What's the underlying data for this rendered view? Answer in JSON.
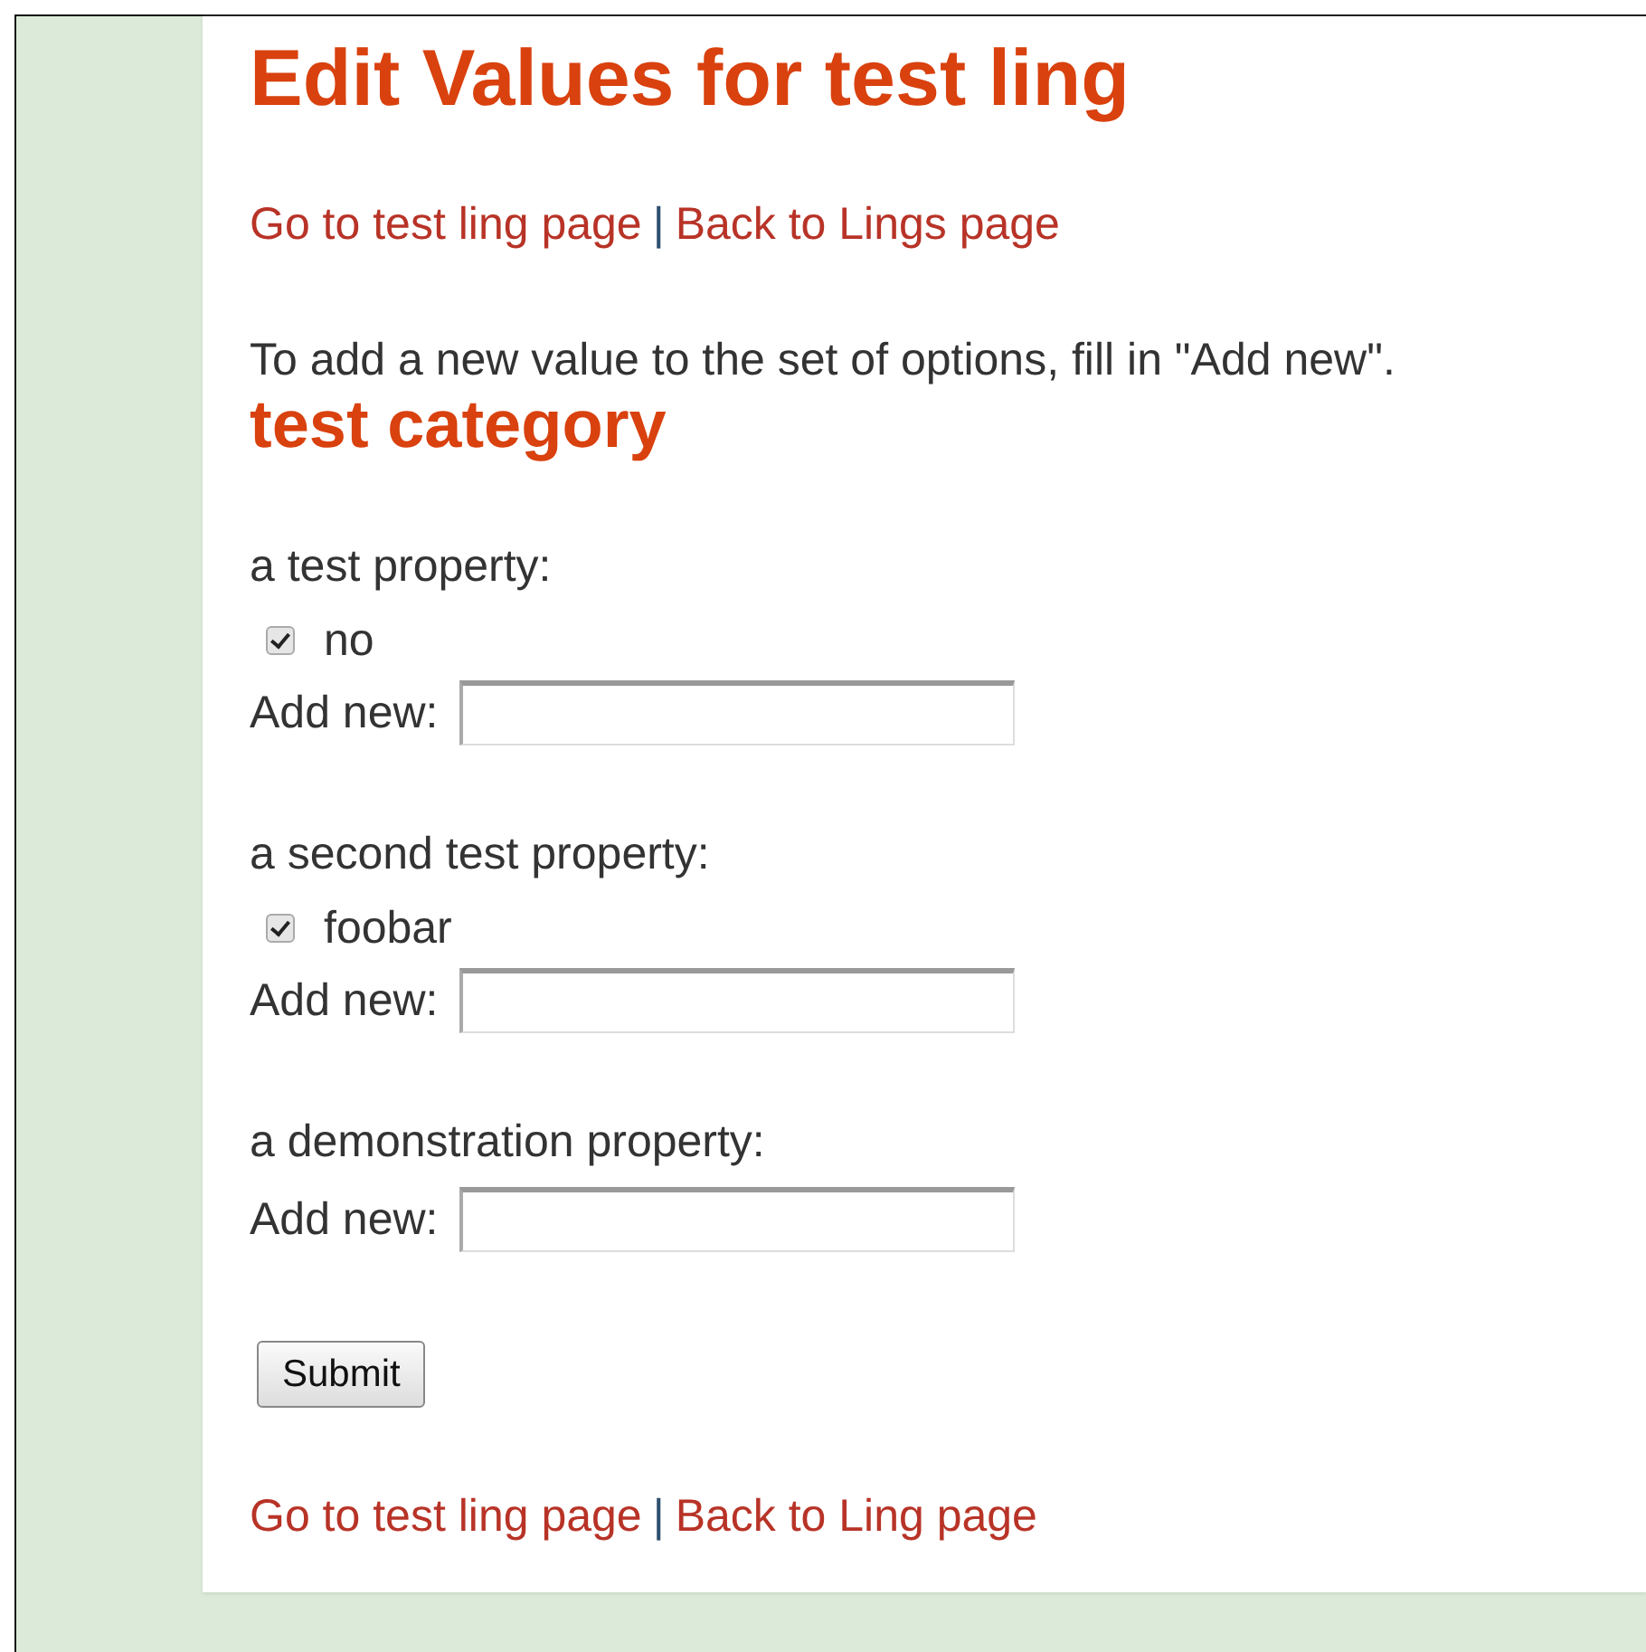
{
  "title": "Edit Values for test ling",
  "top_nav": {
    "links": [
      {
        "label": "Go to test ling page"
      },
      {
        "label": "Back to Lings page"
      }
    ],
    "separator": "|"
  },
  "intro": "To add a new value to the set of options, fill in \"Add new\".",
  "category": "test category",
  "properties": [
    {
      "label": "a test property:",
      "options": [
        {
          "label": "no",
          "checked": true
        }
      ],
      "add_new": "Add new:"
    },
    {
      "label": "a second test property:",
      "options": [
        {
          "label": "foobar",
          "checked": true
        }
      ],
      "add_new": "Add new:"
    },
    {
      "label": "a demonstration property:",
      "add_new": "Add new:"
    }
  ],
  "submit": "Submit",
  "bottom_nav": {
    "links": [
      {
        "label": "Go to test ling page"
      },
      {
        "label": "Back to Ling page"
      }
    ],
    "separator": "|"
  }
}
